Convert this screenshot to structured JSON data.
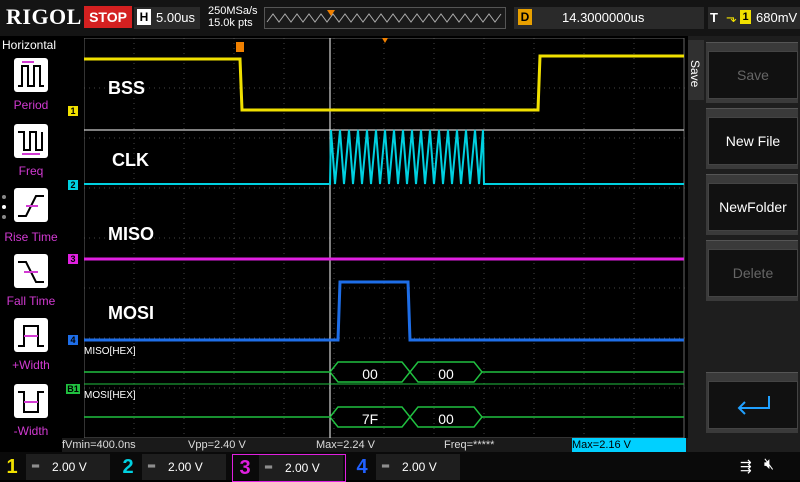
{
  "topbar": {
    "logo": "RIGOL",
    "run_state": "STOP",
    "timebase_key": "H",
    "timebase": "5.00us",
    "sample_rate": "250MSa/s",
    "mem_depth": "15.0k pts",
    "delay_key": "D",
    "delay": "14.3000000us",
    "trig_key": "T",
    "trig_source": "1",
    "trig_level": "680mV"
  },
  "left_panel": {
    "title": "Horizontal",
    "buttons": [
      {
        "label": "Period",
        "icon": "period-icon"
      },
      {
        "label": "Freq",
        "icon": "freq-icon"
      },
      {
        "label": "Rise Time",
        "icon": "rise-time-icon"
      },
      {
        "label": "Fall Time",
        "icon": "fall-time-icon"
      },
      {
        "label": "+Width",
        "icon": "pos-width-icon"
      },
      {
        "label": "-Width",
        "icon": "neg-width-icon"
      }
    ]
  },
  "waveforms": {
    "channel_labels": [
      "BSS",
      "CLK",
      "MISO",
      "MOSI"
    ],
    "channel_markers": [
      "1",
      "2",
      "3",
      "4"
    ],
    "bus_labels": [
      "MISO[HEX]",
      "MOSI[HEX]"
    ],
    "bus_marker": "B1",
    "miso_bytes": [
      "00",
      "00"
    ],
    "mosi_bytes": [
      "7F",
      "00"
    ]
  },
  "right_panel": {
    "tab": "Save",
    "buttons": [
      {
        "label": "Save",
        "enabled": false
      },
      {
        "label": "New File",
        "enabled": true
      },
      {
        "label": "NewFolder",
        "enabled": true
      },
      {
        "label": "Delete",
        "enabled": false
      }
    ],
    "return_icon": "return-arrow-icon"
  },
  "measurements": {
    "vmin": "fVmin=400.0ns",
    "vpp": "Vpp=2.40 V",
    "max": "Max=2.24 V",
    "freq": "Freq=*****",
    "max2": "Max=2.16 V"
  },
  "channels": [
    {
      "num": "1",
      "scale": "2.00 V",
      "color": "#f0e000"
    },
    {
      "num": "2",
      "scale": "2.00 V",
      "color": "#00d0e0"
    },
    {
      "num": "3",
      "scale": "2.00 V",
      "color": "#e020e0"
    },
    {
      "num": "4",
      "scale": "2.00 V",
      "color": "#2060ff"
    }
  ],
  "status_icons": [
    "usb-icon",
    "speaker-muted-icon"
  ],
  "colors": {
    "ch1": "#f0e000",
    "ch2": "#00d0e0",
    "ch3": "#e020e0",
    "ch4": "#1e6ee8",
    "bus": "#20c040",
    "stop": "#d42020"
  }
}
